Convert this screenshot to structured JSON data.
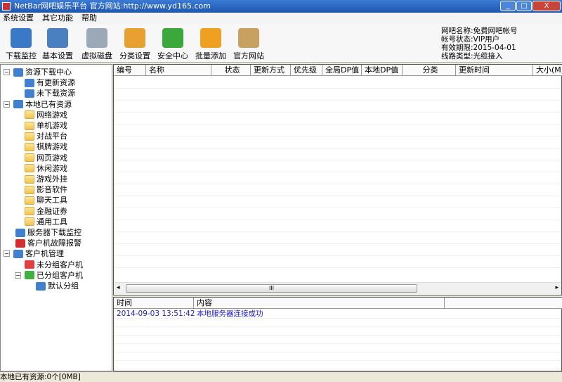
{
  "window": {
    "title": "NetBar网吧娱乐平台 官方网站:http://www.yd165.com",
    "minimize": "_",
    "maximize": "□",
    "close": "X"
  },
  "menu": [
    "系统设置",
    "其它功能",
    "帮助"
  ],
  "toolbar": [
    {
      "label": "下载监控",
      "icon": "monitor-chart-icon",
      "color": "#3a78c8"
    },
    {
      "label": "基本设置",
      "icon": "gear-icon",
      "color": "#4a7fc0"
    },
    {
      "label": "虚拟磁盘",
      "icon": "disk-icon",
      "color": "#9aa8b8"
    },
    {
      "label": "分类设置",
      "icon": "hierarchy-icon",
      "color": "#e8a030"
    },
    {
      "label": "安全中心",
      "icon": "shield-icon",
      "color": "#3aa83a"
    },
    {
      "label": "批量添加",
      "icon": "folder-add-icon",
      "color": "#f0a020"
    },
    {
      "label": "官方网站",
      "icon": "home-icon",
      "color": "#c8a060"
    }
  ],
  "account": [
    "网吧名称:免费网吧帐号",
    "帐号状态:VIP用户",
    "有效期限:2015-04-01",
    "线路类型:光缆接入"
  ],
  "tree": [
    {
      "label": "资源下载中心",
      "level": 0,
      "expander": "−",
      "icon": "download-center-icon"
    },
    {
      "label": "有更新资源",
      "level": 1,
      "icon": "update-icon"
    },
    {
      "label": "未下载资源",
      "level": 1,
      "icon": "not-downloaded-icon"
    },
    {
      "label": "本地已有资源",
      "level": 0,
      "expander": "−",
      "icon": "local-resource-icon"
    },
    {
      "label": "网络游戏",
      "level": 1,
      "icon": "folder-icon"
    },
    {
      "label": "单机游戏",
      "level": 1,
      "icon": "folder-icon"
    },
    {
      "label": "对战平台",
      "level": 1,
      "icon": "folder-icon"
    },
    {
      "label": "棋牌游戏",
      "level": 1,
      "icon": "folder-icon"
    },
    {
      "label": "网页游戏",
      "level": 1,
      "icon": "folder-icon"
    },
    {
      "label": "休闲游戏",
      "level": 1,
      "icon": "folder-icon"
    },
    {
      "label": "游戏外挂",
      "level": 1,
      "icon": "folder-icon"
    },
    {
      "label": "影音软件",
      "level": 1,
      "icon": "folder-icon"
    },
    {
      "label": "聊天工具",
      "level": 1,
      "icon": "folder-icon"
    },
    {
      "label": "金融证券",
      "level": 1,
      "icon": "folder-icon"
    },
    {
      "label": "通用工具",
      "level": 1,
      "icon": "folder-icon"
    },
    {
      "label": "服务器下载监控",
      "level": 0,
      "icon": "server-monitor-icon"
    },
    {
      "label": "客户机故障报警",
      "level": 0,
      "icon": "alarm-icon"
    },
    {
      "label": "客户机管理",
      "level": 0,
      "expander": "−",
      "icon": "client-manage-icon"
    },
    {
      "label": "未分组客户机",
      "level": 1,
      "icon": "client-red-icon"
    },
    {
      "label": "已分组客户机",
      "level": 1,
      "expander": "−",
      "icon": "client-green-icon"
    },
    {
      "label": "默认分组",
      "level": 2,
      "icon": "client-blue-icon"
    }
  ],
  "grid": {
    "columns": [
      "编号",
      "名称",
      "状态",
      "更新方式",
      "优先级",
      "全局DP值",
      "本地DP值",
      "分类",
      "更新时间",
      "大小(M)"
    ],
    "scroll_grip": "III"
  },
  "log": {
    "columns": [
      "时间",
      "内容",
      ""
    ],
    "rows": [
      {
        "time": "2014-09-03 13:51:42",
        "content": "本地服务器连接成功"
      }
    ],
    "text_color": "#1a1ad0"
  },
  "status": "本地已有资源:0个[0MB]"
}
